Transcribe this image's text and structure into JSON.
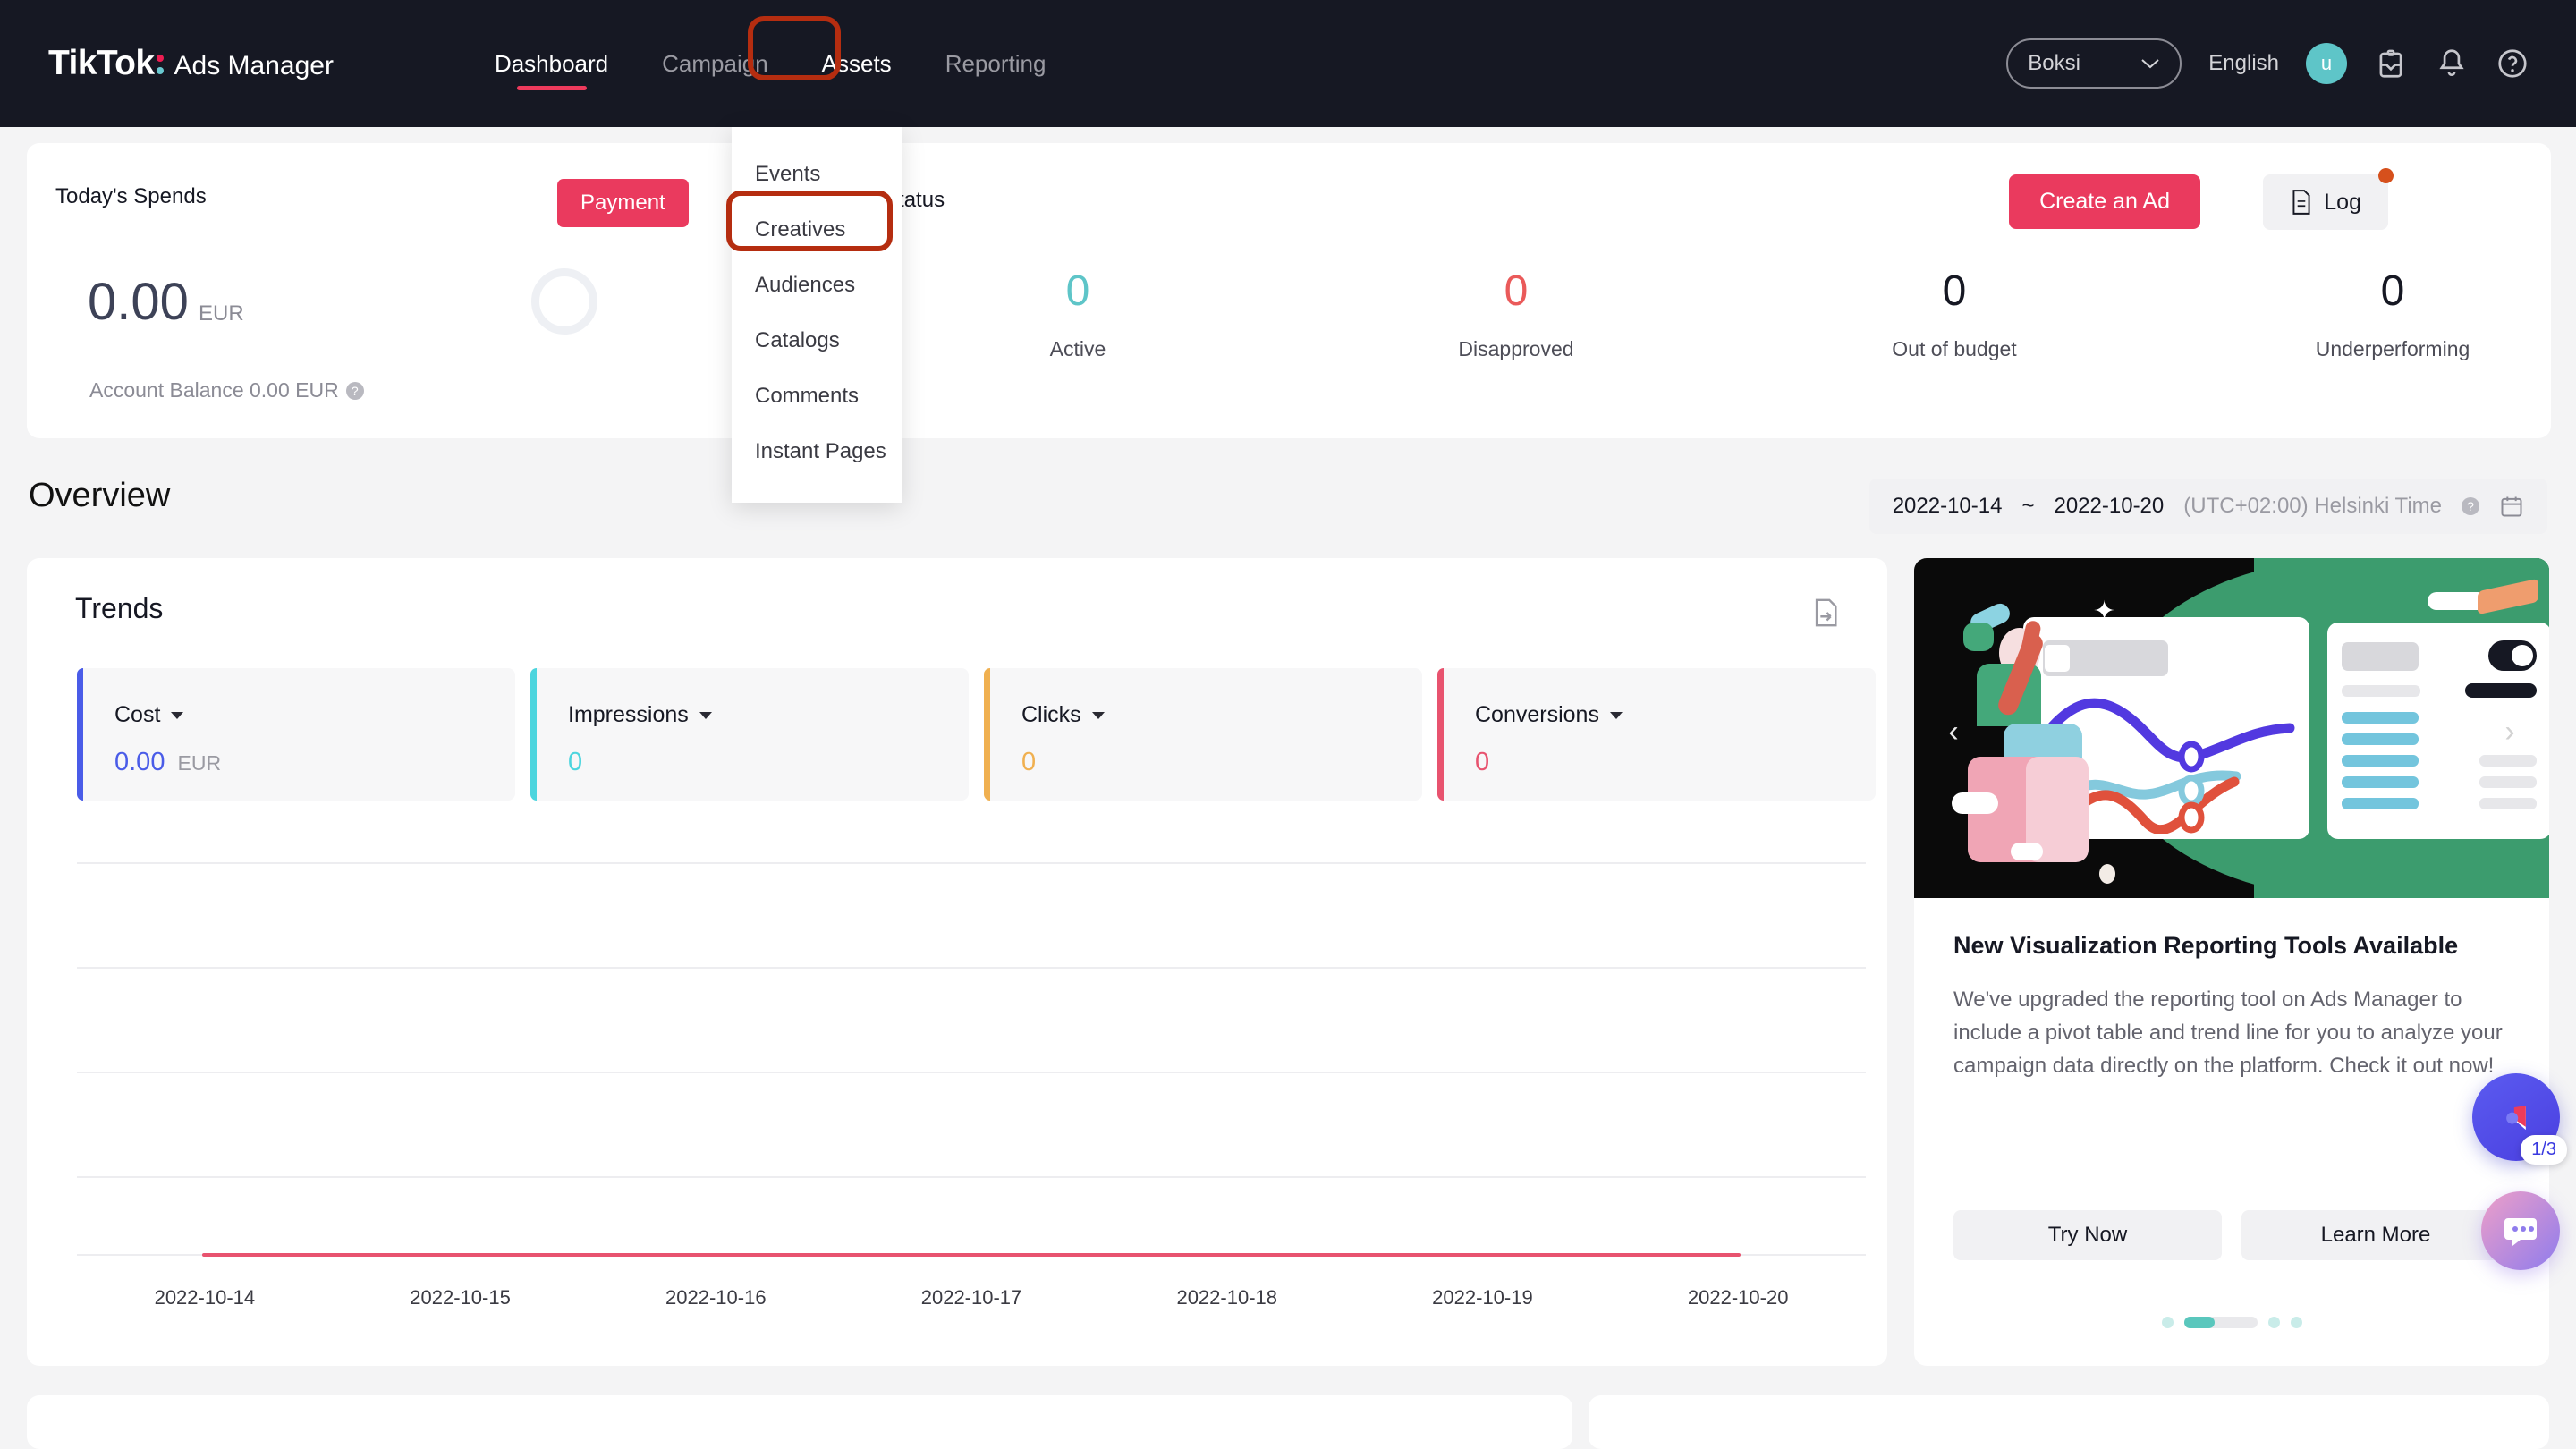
{
  "topnav": {
    "logo_main": "TikTok",
    "logo_sub": "Ads Manager",
    "items": [
      {
        "label": "Dashboard",
        "state": "active"
      },
      {
        "label": "Campaign",
        "state": "default"
      },
      {
        "label": "Assets",
        "state": "selected"
      },
      {
        "label": "Reporting",
        "state": "default"
      }
    ],
    "account": "Boksi",
    "language": "English",
    "avatar_initial": "u",
    "icons": [
      "inbox-icon",
      "bell-icon",
      "help-icon"
    ],
    "highlight_color": "#b52d10"
  },
  "dropdown": {
    "items": [
      "Events",
      "Creatives",
      "Audiences",
      "Catalogs",
      "Comments",
      "Instant Pages"
    ],
    "highlighted": "Creatives"
  },
  "summary": {
    "spend_title": "Today's Spends",
    "spend_amount": "0.00",
    "spend_currency": "EUR",
    "account_balance": "Account Balance 0.00 EUR",
    "payment_label": "Payment",
    "status_label": "Ad Status",
    "create_ad_label": "Create an Ad",
    "log_label": "Log",
    "metrics": [
      {
        "value": "0",
        "label": "Active",
        "color": "#5ec5c8"
      },
      {
        "value": "0",
        "label": "Disapproved",
        "color": "#ea5a5a"
      },
      {
        "value": "0",
        "label": "Out of budget",
        "color": "#161823"
      },
      {
        "value": "0",
        "label": "Underperforming",
        "color": "#161823"
      }
    ]
  },
  "overview": {
    "title": "Overview",
    "date_start": "2022-10-14",
    "date_sep": "~",
    "date_end": "2022-10-20",
    "timezone": "(UTC+02:00) Helsinki Time"
  },
  "trends": {
    "title": "Trends",
    "export_icon": "export-icon",
    "metric_cards": [
      {
        "label": "Cost",
        "value": "0.00",
        "unit": "EUR",
        "color": "#4a5ce8"
      },
      {
        "label": "Impressions",
        "value": "0",
        "unit": "",
        "color": "#4cd5de"
      },
      {
        "label": "Clicks",
        "value": "0",
        "unit": "",
        "color": "#f0b050"
      },
      {
        "label": "Conversions",
        "value": "0",
        "unit": "",
        "color": "#e8536f"
      }
    ]
  },
  "chart_data": {
    "type": "line",
    "title": "Trends",
    "x": [
      "2022-10-14",
      "2022-10-15",
      "2022-10-16",
      "2022-10-17",
      "2022-10-18",
      "2022-10-19",
      "2022-10-20"
    ],
    "series": [
      {
        "name": "Cost",
        "values": [
          0,
          0,
          0,
          0,
          0,
          0,
          0
        ],
        "color": "#4a5ce8"
      },
      {
        "name": "Impressions",
        "values": [
          0,
          0,
          0,
          0,
          0,
          0,
          0
        ],
        "color": "#4cd5de"
      },
      {
        "name": "Clicks",
        "values": [
          0,
          0,
          0,
          0,
          0,
          0,
          0
        ],
        "color": "#f0b050"
      },
      {
        "name": "Conversions",
        "values": [
          0,
          0,
          0,
          0,
          0,
          0,
          0
        ],
        "color": "#e8536f"
      }
    ],
    "xlabel": "",
    "ylabel": "",
    "ylim": [
      0,
      1
    ],
    "grid": true,
    "legend": "none",
    "note": "All series flat at zero; a single pink zero-line is rendered along the baseline."
  },
  "promo": {
    "title": "New Visualization Reporting Tools Available",
    "body": "We've upgraded the reporting tool on Ads Manager to include a pivot table and trend line for you to analyze your campaign data directly on the platform. Check it out now!",
    "primary_label": "Try Now",
    "secondary_label": "Learn More",
    "prev_icon": "chevron-left-icon",
    "next_icon": "chevron-right-icon",
    "dots_total": 4,
    "dots_active_index": 1
  },
  "floating": {
    "megaphone_badge": "1/3",
    "megaphone_icon": "megaphone-icon",
    "chat_icon": "chat-bubble-icon"
  }
}
